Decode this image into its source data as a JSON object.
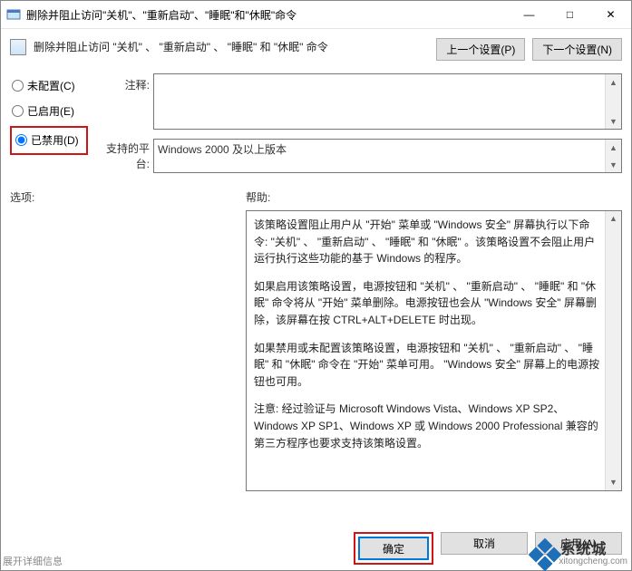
{
  "window": {
    "title": "删除并阻止访问\"关机\"、\"重新启动\"、\"睡眠\"和\"休眠\"命令",
    "min_icon": "—",
    "max_icon": "□",
    "close_icon": "✕"
  },
  "header": {
    "policy_title": "删除并阻止访问 \"关机\" 、 \"重新启动\" 、 \"睡眠\" 和 \"休眠\" 命令",
    "prev_btn": "上一个设置(P)",
    "next_btn": "下一个设置(N)"
  },
  "radios": {
    "not_configured": "未配置(C)",
    "enabled": "已启用(E)",
    "disabled": "已禁用(D)",
    "selected": "disabled"
  },
  "labels": {
    "comment": "注释:",
    "platform": "支持的平台:",
    "options": "选项:",
    "help": "帮助:"
  },
  "platform_text": "Windows 2000 及以上版本",
  "help_paragraphs": [
    "该策略设置阻止用户从 \"开始\" 菜单或 \"Windows 安全\" 屏幕执行以下命令: \"关机\" 、 \"重新启动\" 、 \"睡眠\" 和 \"休眠\" 。该策略设置不会阻止用户运行执行这些功能的基于 Windows 的程序。",
    "如果启用该策略设置，电源按钮和 \"关机\" 、 \"重新启动\" 、 \"睡眠\" 和 \"休眠\" 命令将从 \"开始\" 菜单删除。电源按钮也会从 \"Windows 安全\" 屏幕删除，该屏幕在按 CTRL+ALT+DELETE 时出现。",
    "如果禁用或未配置该策略设置，电源按钮和 \"关机\" 、 \"重新启动\" 、 \"睡眠\" 和 \"休眠\" 命令在 \"开始\" 菜单可用。 \"Windows 安全\" 屏幕上的电源按钮也可用。",
    "注意: 经过验证与 Microsoft Windows Vista、Windows XP SP2、Windows XP SP1、Windows XP 或 Windows 2000 Professional 兼容的第三方程序也要求支持该策略设置。"
  ],
  "footer": {
    "ok": "确定",
    "cancel": "取消",
    "apply": "应用(A)"
  },
  "watermark": {
    "brand": "系统城",
    "url": "xitongcheng.com"
  },
  "bottom_hint": "展开详细信息"
}
